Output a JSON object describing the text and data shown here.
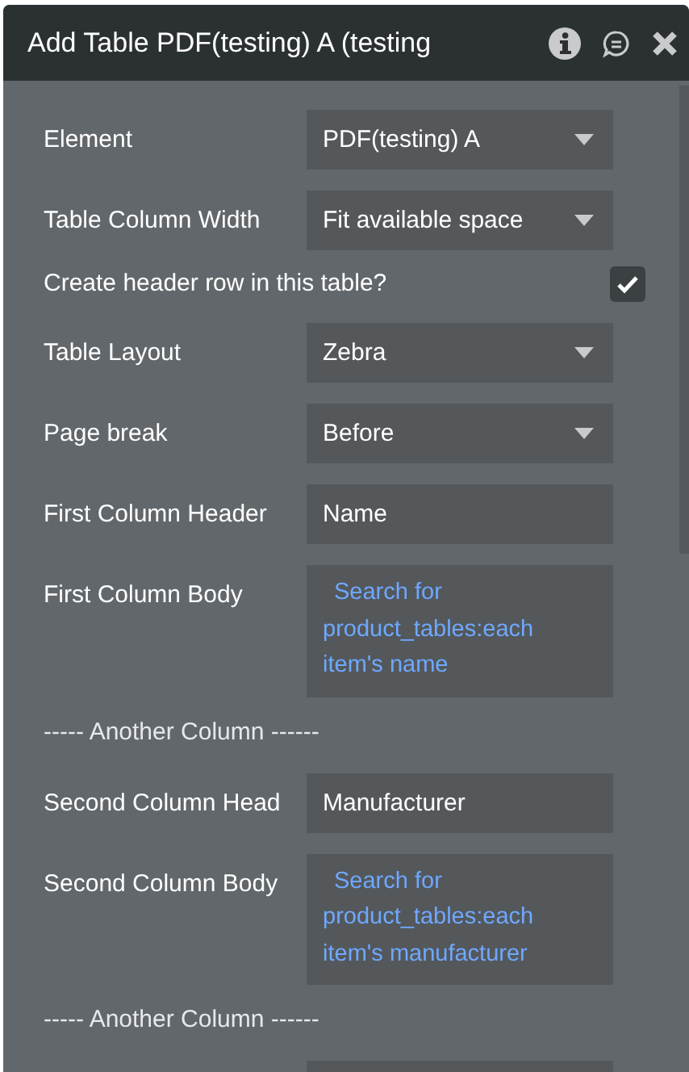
{
  "window": {
    "title": "Add Table PDF(testing) A (testing"
  },
  "rows": [
    {
      "kind": "dropdown",
      "label": "Element",
      "value": "PDF(testing) A"
    },
    {
      "kind": "dropdown",
      "label": "Table Column Width",
      "value": "Fit available space"
    },
    {
      "kind": "checkbox",
      "label": "Create header row in this table?",
      "checked": true
    },
    {
      "kind": "dropdown",
      "label": "Table Layout",
      "value": "Zebra"
    },
    {
      "kind": "dropdown",
      "label": "Page break",
      "value": "Before"
    },
    {
      "kind": "text",
      "label": "First Column Header",
      "value": "Name"
    },
    {
      "kind": "expression",
      "label": "First Column Body",
      "value": "Search for product_tables:each item's name"
    },
    {
      "kind": "separator",
      "label": "----- Another Column ------"
    },
    {
      "kind": "text",
      "label": "Second Column Head",
      "value": "Manufacturer"
    },
    {
      "kind": "expression",
      "label": "Second Column Body",
      "value": "Search for product_tables:each item's manufacturer"
    },
    {
      "kind": "separator",
      "label": "----- Another Column ------"
    },
    {
      "kind": "text",
      "label": "",
      "value": ""
    }
  ]
}
